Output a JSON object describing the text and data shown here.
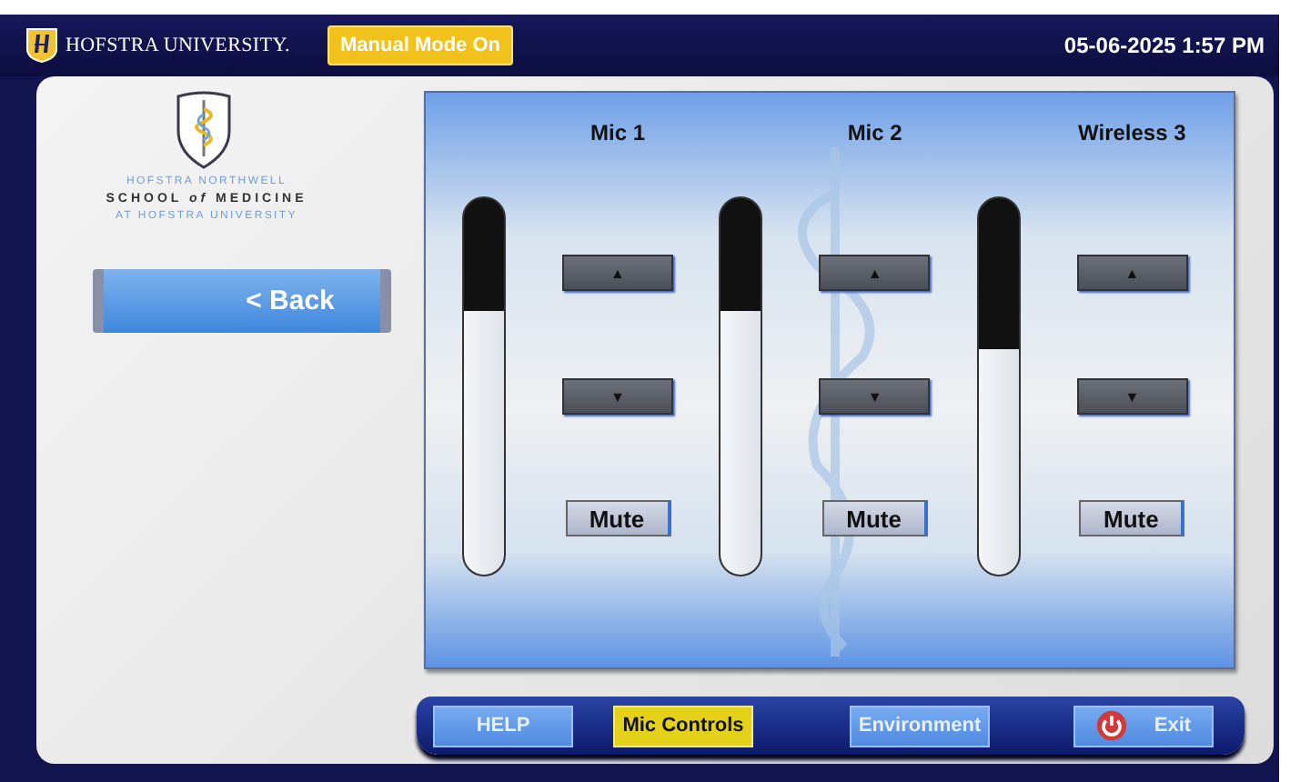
{
  "header": {
    "brand": "HOFSTRA UNIVERSITY.",
    "mode_badge": "Manual Mode On",
    "datetime": "05-06-2025 1:57 PM"
  },
  "school": {
    "lines": [
      "HOFSTRA NORTHWELL",
      "SCHOOL *of* MEDICINE",
      "AT HOFSTRA UNIVERSITY"
    ]
  },
  "back_button": "< Back",
  "channels": [
    {
      "name": "Mic 1",
      "level": 0.7,
      "up": "▲",
      "down": "▼",
      "mute": "Mute"
    },
    {
      "name": "Mic 2",
      "level": 0.7,
      "up": "▲",
      "down": "▼",
      "mute": "Mute"
    },
    {
      "name": "Wireless 3",
      "level": 0.6,
      "up": "▲",
      "down": "▼",
      "mute": "Mute"
    }
  ],
  "nav": [
    {
      "label": "HELP",
      "selected": false,
      "kind": "plain"
    },
    {
      "label": "Mic Controls",
      "selected": true,
      "kind": "plain"
    },
    {
      "label": "Environment",
      "selected": false,
      "kind": "plain"
    },
    {
      "label": "Exit",
      "selected": false,
      "kind": "power"
    }
  ]
}
